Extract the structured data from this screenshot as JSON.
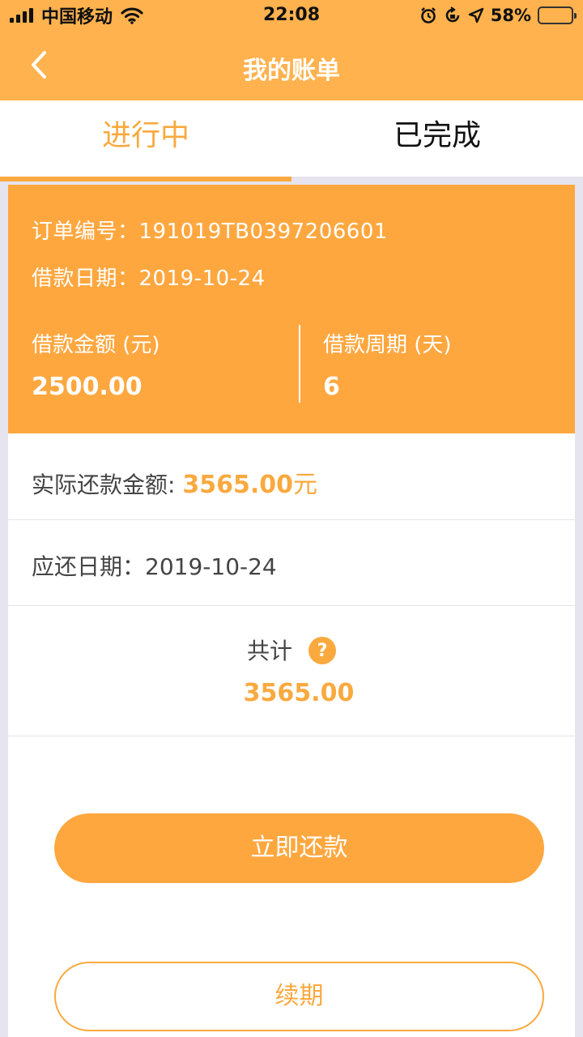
{
  "status_bar": {
    "carrier": "中国移动",
    "time": "22:08",
    "battery_percent": "58%",
    "battery_level": 0.58,
    "icons": [
      "signal-icon",
      "wifi-icon",
      "alarm-icon",
      "rotation-lock-icon",
      "location-icon",
      "battery-icon"
    ]
  },
  "nav": {
    "title": "我的账单",
    "back_icon": "chevron-left-icon"
  },
  "tabs": [
    {
      "label": "进行中",
      "active": true
    },
    {
      "label": "已完成",
      "active": false
    }
  ],
  "order": {
    "number_label": "订单编号：",
    "number_value": "191019TB0397206601",
    "date_label": "借款日期：",
    "date_value": "2019-10-24",
    "amount_label": "借款金额 (元)",
    "amount_value": "2500.00",
    "period_label": "借款周期 (天)",
    "period_value": "6"
  },
  "actual_repay": {
    "label": "实际还款金额: ",
    "amount": "3565.00",
    "unit": "元"
  },
  "due_date": {
    "label": "应还日期：",
    "value": "2019-10-24"
  },
  "total": {
    "label": "共计",
    "help_icon": "?",
    "value": "3565.00"
  },
  "buttons": {
    "repay": "立即还款",
    "renew": "续期"
  },
  "colors": {
    "accent": "#f9a93e",
    "header": "#ffb24e",
    "card_head": "#ffa73f",
    "background": "#e6e4ee"
  }
}
